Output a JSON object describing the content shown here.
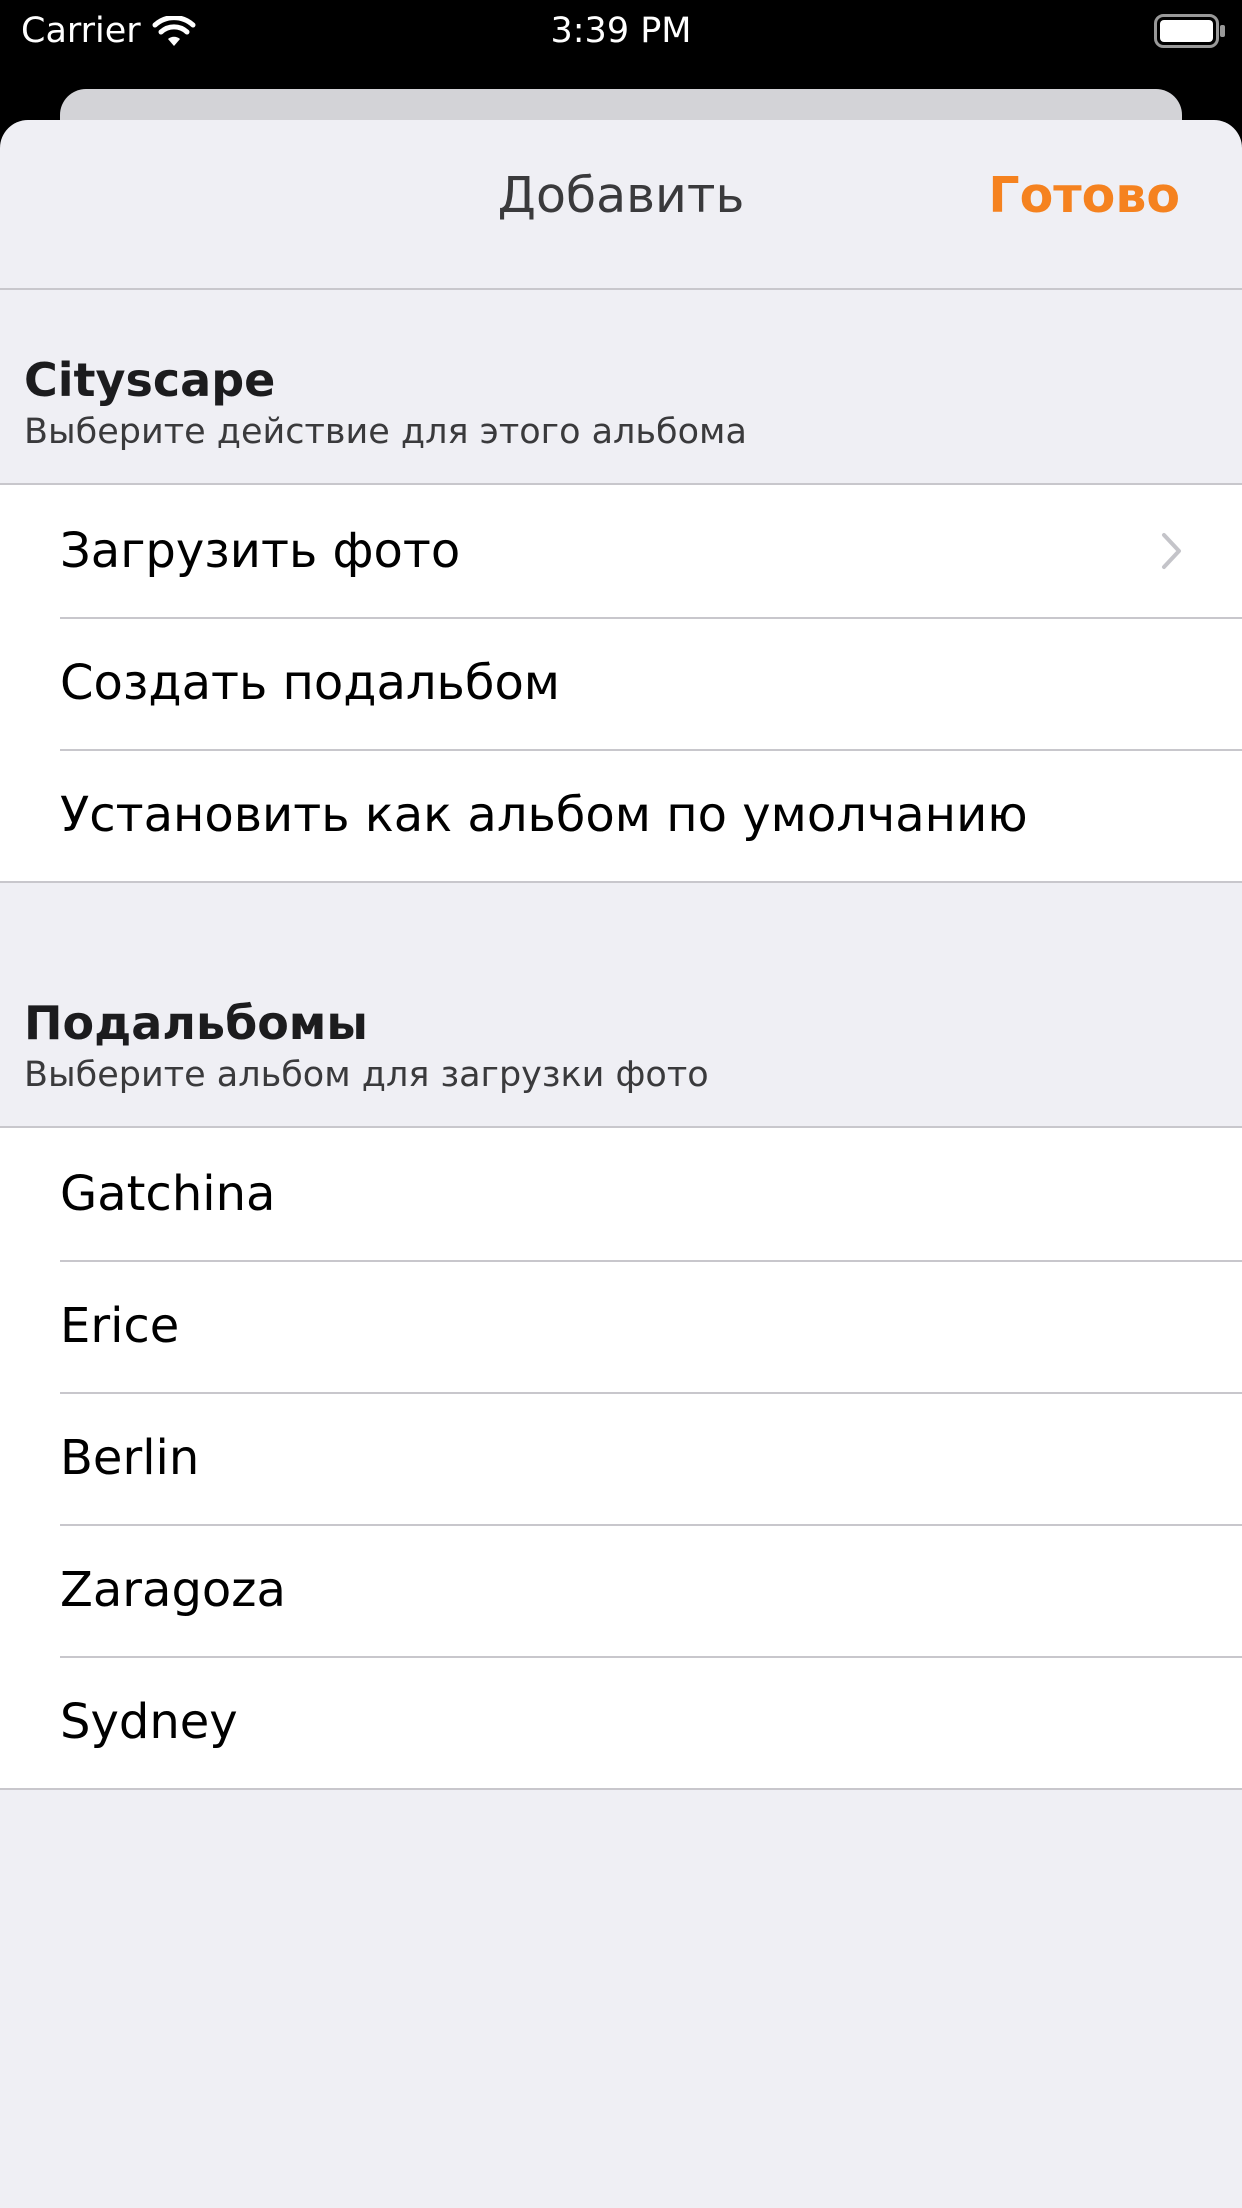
{
  "status_bar": {
    "carrier": "Carrier",
    "time": "3:39 PM"
  },
  "nav": {
    "title": "Добавить",
    "done_label": "Готово",
    "accent_color": "#f5821f"
  },
  "album_section": {
    "title": "Cityscape",
    "subtitle": "Выберите действие для этого альбома",
    "actions": [
      {
        "label": "Загрузить фото",
        "icon": "chevron-right-icon"
      },
      {
        "label": "Создать подальбом"
      },
      {
        "label": "Установить как альбом по умолчанию"
      }
    ]
  },
  "subalbums_section": {
    "title": "Подальбомы",
    "subtitle": "Выберите альбом для загрузки фото",
    "items": [
      {
        "label": "Gatchina"
      },
      {
        "label": "Erice"
      },
      {
        "label": "Berlin"
      },
      {
        "label": "Zaragoza"
      },
      {
        "label": "Sydney"
      }
    ]
  }
}
